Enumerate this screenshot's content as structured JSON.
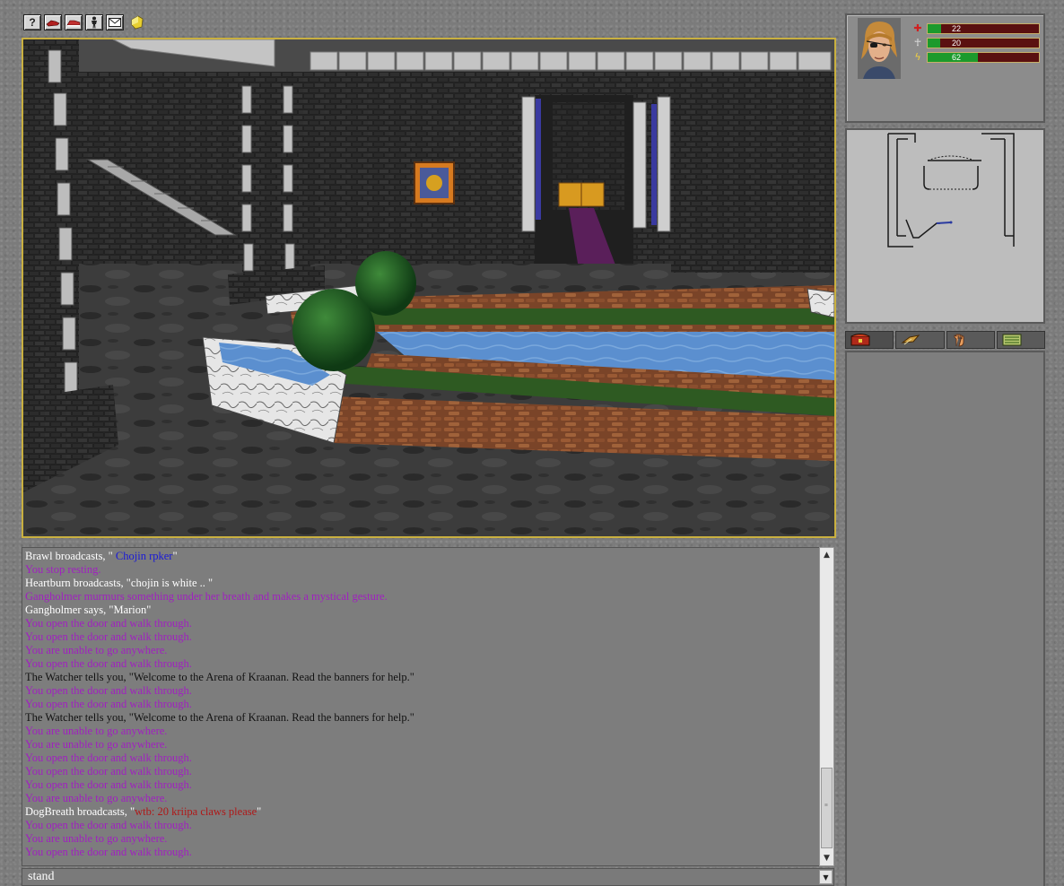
{
  "toolbar": {
    "buttons": [
      {
        "icon": "help-icon"
      },
      {
        "icon": "sneak-icon"
      },
      {
        "icon": "run-icon"
      },
      {
        "icon": "character-icon"
      },
      {
        "icon": "mail-icon"
      }
    ],
    "extra_icon": "gem-icon"
  },
  "chat": {
    "lines": [
      [
        {
          "t": "Brawl broadcasts, \" ",
          "c": "white"
        },
        {
          "t": "Chojin rpker",
          "c": "blue"
        },
        {
          "t": "\"",
          "c": "white"
        }
      ],
      [
        {
          "t": "You stop resting.",
          "c": "magenta"
        }
      ],
      [
        {
          "t": "Heartburn broadcasts, \"chojin is white .. \"",
          "c": "white"
        }
      ],
      [
        {
          "t": "Gangholmer murmurs something under her breath and makes a mystical gesture.",
          "c": "magenta"
        }
      ],
      [
        {
          "t": "Gangholmer says, \"Marion\"",
          "c": "white"
        }
      ],
      [
        {
          "t": "You open the door and walk through.",
          "c": "magenta"
        }
      ],
      [
        {
          "t": "You open the door and walk through.",
          "c": "magenta"
        }
      ],
      [
        {
          "t": "You are unable to go anywhere.",
          "c": "magenta"
        }
      ],
      [
        {
          "t": "You open the door and walk through.",
          "c": "magenta"
        }
      ],
      [
        {
          "t": "The Watcher tells you, \"Welcome to the Arena of Kraanan.  Read the banners for help.\"",
          "c": "dark"
        }
      ],
      [
        {
          "t": "You open the door and walk through.",
          "c": "magenta"
        }
      ],
      [
        {
          "t": "You open the door and walk through.",
          "c": "magenta"
        }
      ],
      [
        {
          "t": "The Watcher tells you, \"Welcome to the Arena of Kraanan.  Read the banners for help.\"",
          "c": "dark"
        }
      ],
      [
        {
          "t": "You are unable to go anywhere.",
          "c": "magenta"
        }
      ],
      [
        {
          "t": "You are unable to go anywhere.",
          "c": "magenta"
        }
      ],
      [
        {
          "t": "You open the door and walk through.",
          "c": "magenta"
        }
      ],
      [
        {
          "t": "You open the door and walk through.",
          "c": "magenta"
        }
      ],
      [
        {
          "t": "You open the door and walk through.",
          "c": "magenta"
        }
      ],
      [
        {
          "t": "You are unable to go anywhere.",
          "c": "magenta"
        }
      ],
      [
        {
          "t": "DogBreath broadcasts, \"",
          "c": "white"
        },
        {
          "t": "wtb: 20 kriipa claws please",
          "c": "red"
        },
        {
          "t": "\"",
          "c": "white"
        }
      ],
      [
        {
          "t": "You open the door and walk through.",
          "c": "magenta"
        }
      ],
      [
        {
          "t": "You are unable to go anywhere.",
          "c": "magenta"
        }
      ],
      [
        {
          "t": "You open the door and walk through.",
          "c": "magenta"
        }
      ]
    ]
  },
  "command": {
    "value": "stand"
  },
  "character": {
    "stats": [
      {
        "name": "health",
        "icon": "heart-icon",
        "value": "22",
        "fraction": 0.12
      },
      {
        "name": "mana",
        "icon": "ankh-icon",
        "value": "20",
        "fraction": 0.11
      },
      {
        "name": "stamina",
        "icon": "lightning-icon",
        "value": "62",
        "fraction": 0.45
      }
    ]
  },
  "tabs": [
    {
      "name": "inventory",
      "icon": "chest-icon"
    },
    {
      "name": "skills",
      "icon": "spellbook-icon"
    },
    {
      "name": "equipment",
      "icon": "hand-icon"
    },
    {
      "name": "macros",
      "icon": "list-icon"
    }
  ],
  "colors": {
    "white": "#ffffff",
    "magenta": "#a020c0",
    "dark": "#111111",
    "blue": "#1818d8",
    "red": "#b01818",
    "viewport_border": "#c9b040"
  }
}
